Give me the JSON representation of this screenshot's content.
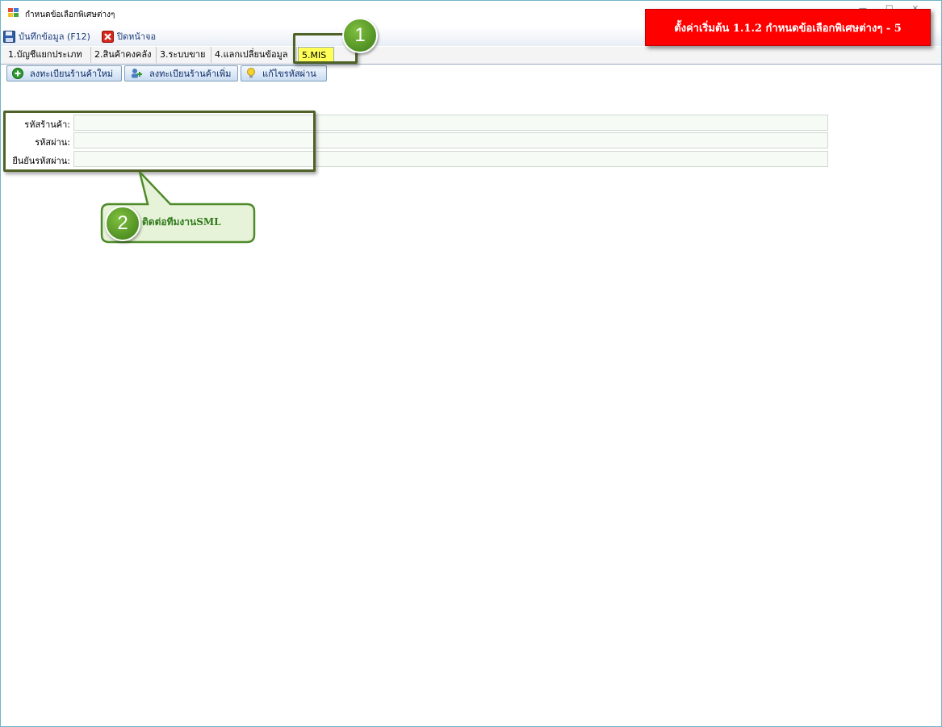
{
  "window": {
    "title": "กำหนดข้อเลือกพิเศษต่างๆ",
    "controls": "— □ ×"
  },
  "toolbar": {
    "save_label": "บันทึกข้อมูล (F12)",
    "close_label": "ปิดหน้าจอ"
  },
  "tabs": [
    {
      "label": "1.บัญชีแยกประเภท"
    },
    {
      "label": "2.สินค้าคงคลัง"
    },
    {
      "label": "3.ระบบขาย"
    },
    {
      "label": "4.แลกเปลี่ยนข้อมูล"
    },
    {
      "label": "5.MIS"
    }
  ],
  "actions": {
    "register_new": "ลงทะเบียนร้านค้าใหม่",
    "register_more": "ลงทะเบียนร้านค้าเพิ่ม",
    "edit_password": "แก้ไขรหัสผ่าน"
  },
  "form": {
    "shop_code_label": "รหัสร้านค้า:",
    "shop_code_value": "",
    "password_label": "รหัสผ่าน:",
    "password_value": "",
    "confirm_password_label": "ยืนยันรหัสผ่าน:",
    "confirm_password_value": ""
  },
  "annotations": {
    "badge_1": "1",
    "badge_2": "2",
    "callout_text": "ติดต่อทีมงานSML",
    "banner_text": "ตั้งค่าเริ่มต้น 1.1.2  กำหนดข้อเลือกพิเศษต่างๆ - 5",
    "accent_color": "#4f6228",
    "banner_color": "#ff0000",
    "tab_highlight_color": "#ffff55"
  }
}
